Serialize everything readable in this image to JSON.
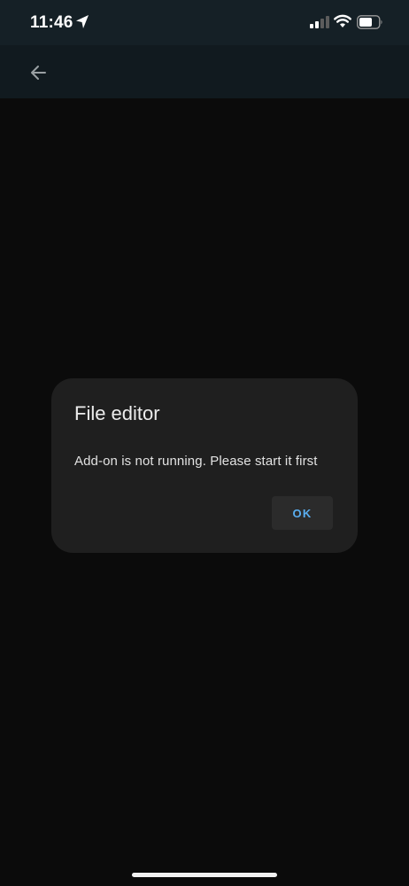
{
  "status_bar": {
    "time": "11:46",
    "icons": [
      "location-arrow-icon",
      "cellular-signal-icon",
      "wifi-icon",
      "battery-icon"
    ]
  },
  "app_bar": {
    "back_icon": "arrow-left-icon"
  },
  "dialog": {
    "title": "File editor",
    "message": "Add-on is not running. Please start it first",
    "ok_label": "OK"
  },
  "colors": {
    "background": "#0b0b0b",
    "status_bar_bg": "#152026",
    "app_bar_bg": "#111a1f",
    "dialog_bg": "#1f1f1f",
    "button_bg": "#2b2b2b",
    "accent": "#5aaef0"
  }
}
